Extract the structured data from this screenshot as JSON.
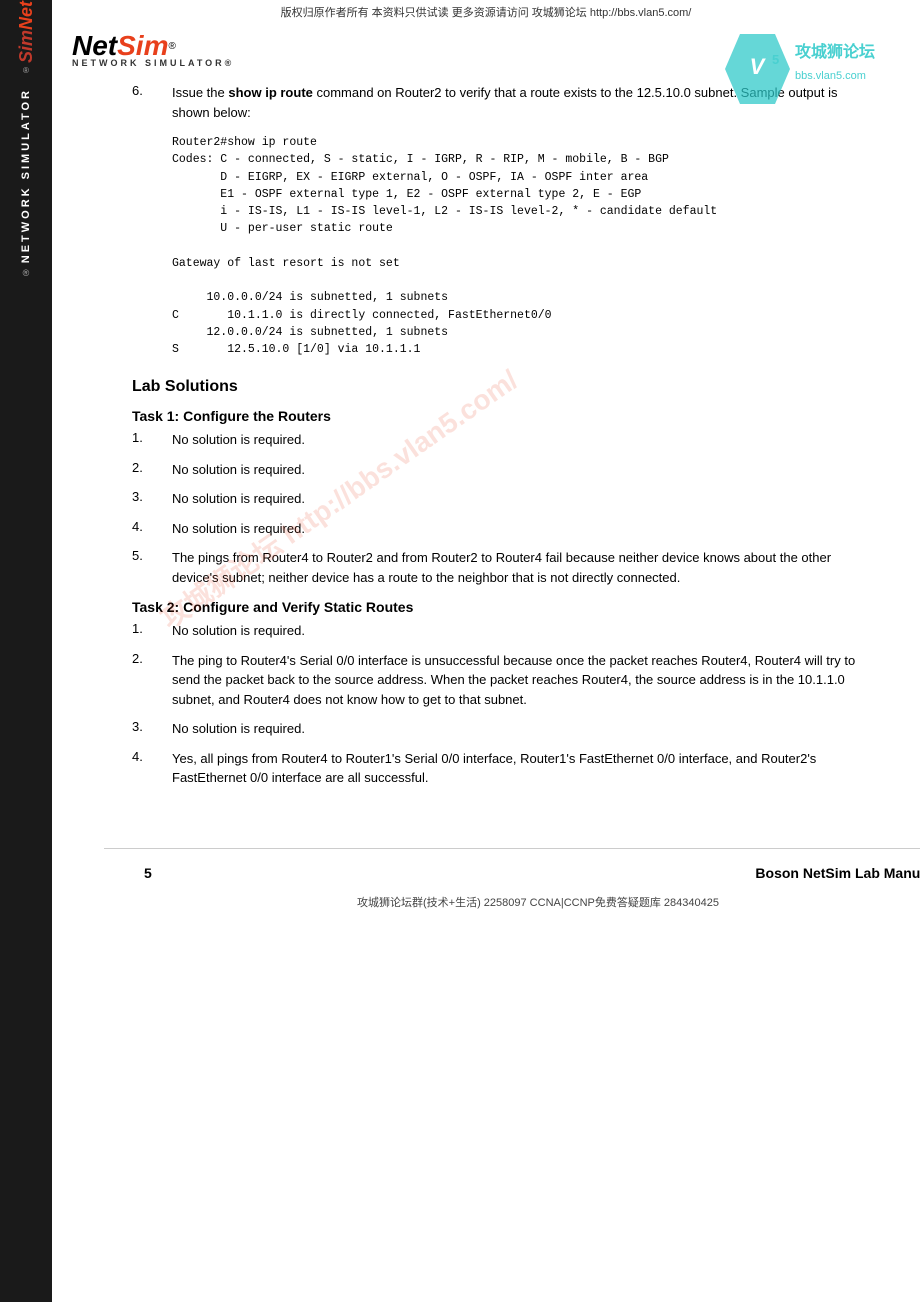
{
  "top_watermark": "版权归原作者所有  本资料只供试读  更多资源请访问  攻城狮论坛  http://bbs.vlan5.com/",
  "logo": {
    "net": "Net",
    "sim": "Sim",
    "reg": "®",
    "subtitle": "NETWORK SIMULATOR®"
  },
  "sidebar": {
    "brand": "NetSim",
    "vertical_text": "NETWORK SIMULATOR",
    "reg": "®"
  },
  "step6": {
    "number": "6.",
    "text_before": "Issue the ",
    "command": "show ip route",
    "text_after": " command on Router2 to verify that a route exists to the 12.5.10.0 subnet. Sample output is shown below:"
  },
  "code_block": "Router2#show ip route\nCodes: C - connected, S - static, I - IGRP, R - RIP, M - mobile, B - BGP\n       D - EIGRP, EX - EIGRP external, O - OSPF, IA - OSPF inter area\n       E1 - OSPF external type 1, E2 - OSPF external type 2, E - EGP\n       i - IS-IS, L1 - IS-IS level-1, L2 - IS-IS level-2, * - candidate default\n       U - per-user static route\n\nGateway of last resort is not set\n\n     10.0.0.0/24 is subnetted, 1 subnets\nC       10.1.1.0 is directly connected, FastEthernet0/0\n     12.0.0.0/24 is subnetted, 1 subnets\nS       12.5.10.0 [1/0] via 10.1.1.1",
  "lab_solutions": {
    "header": "Lab Solutions",
    "task1": {
      "header": "Task 1: Configure the Routers",
      "items": [
        {
          "num": "1.",
          "text": "No solution is required."
        },
        {
          "num": "2.",
          "text": "No solution is required."
        },
        {
          "num": "3.",
          "text": "No solution is required."
        },
        {
          "num": "4.",
          "text": "No solution is required."
        },
        {
          "num": "5.",
          "text": "The pings from Router4 to Router2 and from Router2 to Router4 fail because neither device knows about the other device's subnet; neither device has a route to the neighbor that is not directly connected."
        }
      ]
    },
    "task2": {
      "header": "Task 2: Configure and Verify Static Routes",
      "items": [
        {
          "num": "1.",
          "text": "No solution is required."
        },
        {
          "num": "2.",
          "text": "The ping to Router4's Serial 0/0 interface is unsuccessful because once the packet reaches Router4, Router4 will try to send the packet back to the source address. When the packet reaches Router4, the source address is in the 10.1.1.0 subnet, and Router4 does not know how to get to that subnet."
        },
        {
          "num": "3.",
          "text": "No solution is required."
        },
        {
          "num": "4.",
          "text": "Yes, all pings from Router4 to Router1's Serial 0/0 interface, Router1's FastEthernet 0/0 interface, and Router2's FastEthernet 0/0 interface are all successful."
        }
      ]
    }
  },
  "footer": {
    "page": "5",
    "title": "Boson NetSim Lab Manual"
  },
  "bottom_watermark": "攻城狮论坛群(技术+生活)  2258097  CCNA|CCNP免费答疑题库  284340425",
  "watermark_text": "攻城狮论坛  http://bbs.vlan5.com/"
}
